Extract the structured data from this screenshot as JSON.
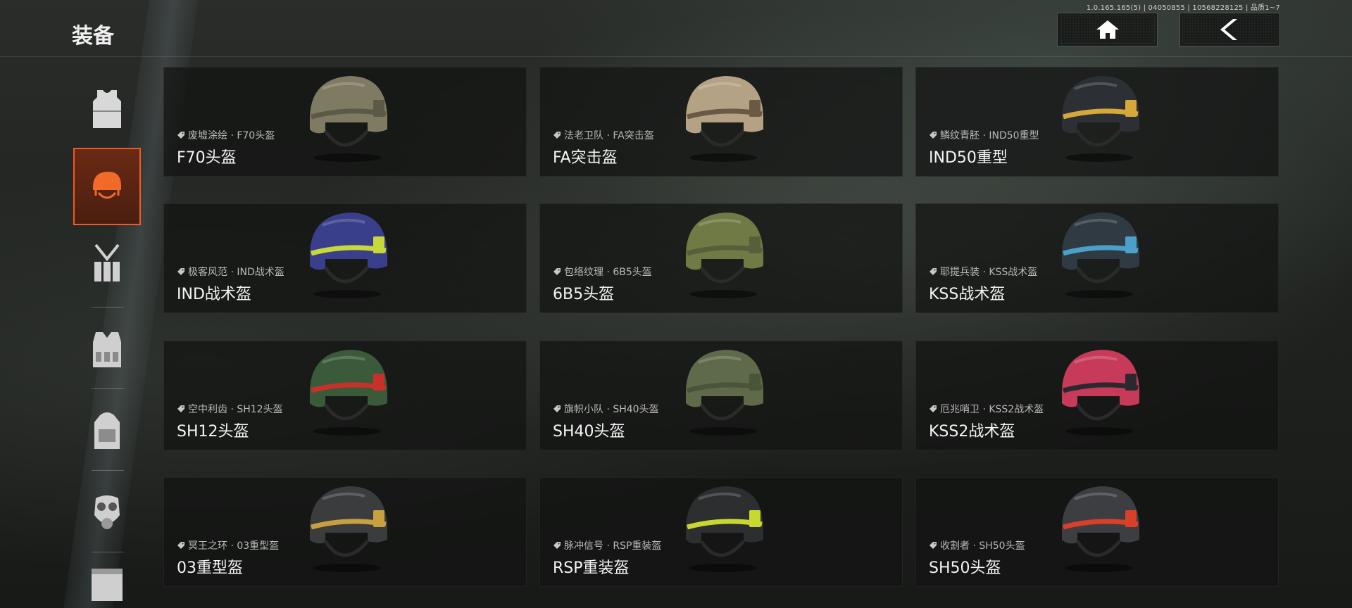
{
  "version": "1.0.165.165(5) | 04050855 | 10568228125 | 品质1~7",
  "title": "装备",
  "top_buttons": {
    "home": "home-icon",
    "back": "back-chevron-icon"
  },
  "sidebar": {
    "items": [
      {
        "icon": "body-armor-icon",
        "active": false
      },
      {
        "icon": "helmet-icon",
        "active": true
      },
      {
        "icon": "chest-rig-icon",
        "active": false
      },
      {
        "icon": "tactical-vest-icon",
        "active": false
      },
      {
        "icon": "backpack-icon",
        "active": false
      },
      {
        "icon": "gas-mask-icon",
        "active": false
      },
      {
        "icon": "container-icon",
        "active": false
      }
    ]
  },
  "helmets": [
    {
      "skin": "废墟涂绘 · F70头盔",
      "name": "F70头盔",
      "shell": "#7f7a62",
      "accent": "#5b5a48"
    },
    {
      "skin": "法老卫队 · FA突击盔",
      "name": "FA突击盔",
      "shell": "#b5a184",
      "accent": "#6a5a44"
    },
    {
      "skin": "鳞纹青胚 · IND50重型",
      "name": "IND50重型",
      "shell": "#2c3034",
      "accent": "#d6a83a"
    },
    {
      "skin": "极客风范 · IND战术盔",
      "name": "IND战术盔",
      "shell": "#3a3f8c",
      "accent": "#c8d83a"
    },
    {
      "skin": "包络纹理 · 6B5头盔",
      "name": "6B5头盔",
      "shell": "#6f7a44",
      "accent": "#55603a"
    },
    {
      "skin": "耶提兵装 · KSS战术盔",
      "name": "KSS战术盔",
      "shell": "#2f3a42",
      "accent": "#4aa0c8"
    },
    {
      "skin": "空中利齿 · SH12头盔",
      "name": "SH12头盔",
      "shell": "#3a5a3a",
      "accent": "#c8302a"
    },
    {
      "skin": "旗帜小队 · SH40头盔",
      "name": "SH40头盔",
      "shell": "#5e6a4a",
      "accent": "#4a5438"
    },
    {
      "skin": "厄兆哨卫 · KSS2战术盔",
      "name": "KSS2战术盔",
      "shell": "#c83a5a",
      "accent": "#2a2a2e"
    },
    {
      "skin": "冥王之环 · 03重型盔",
      "name": "03重型盔",
      "shell": "#3a3c3e",
      "accent": "#c8a040"
    },
    {
      "skin": "脉冲信号 · RSP重装盔",
      "name": "RSP重装盔",
      "shell": "#2c2e30",
      "accent": "#c8d830"
    },
    {
      "skin": "收割者 · SH50头盔",
      "name": "SH50头盔",
      "shell": "#3c3e42",
      "accent": "#d8402a"
    }
  ]
}
